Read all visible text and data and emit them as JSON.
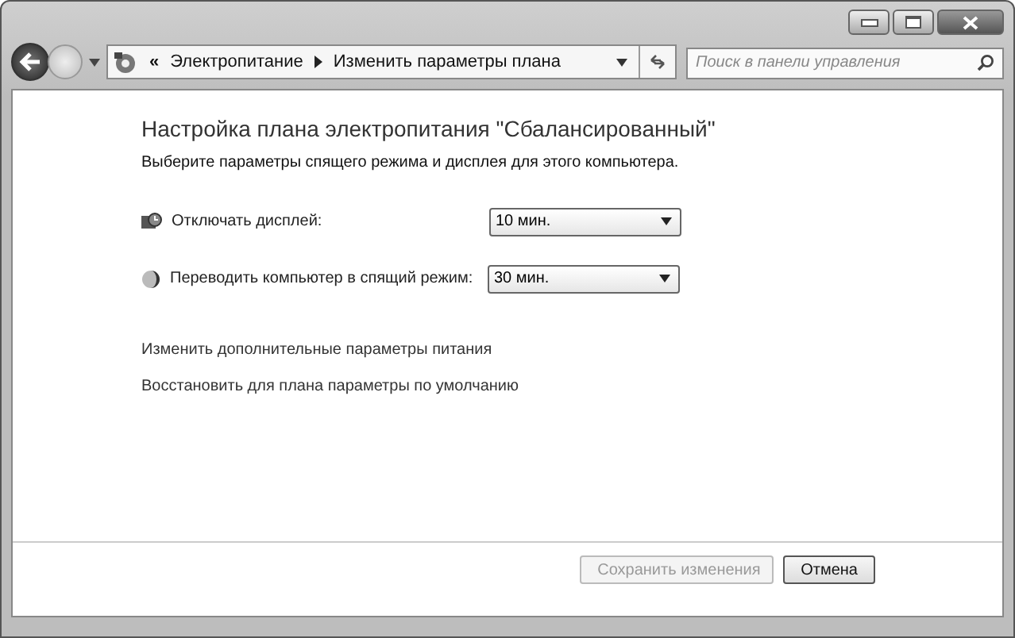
{
  "address_bar": {
    "overflow": "«",
    "crumbs": [
      "Электропитание",
      "Изменить параметры плана"
    ]
  },
  "search": {
    "placeholder": "Поиск в панели управления"
  },
  "heading": "Настройка плана электропитания \"Сбалансированный\"",
  "subtitle": "Выберите параметры спящего режима и дисплея для этого компьютера.",
  "settings": [
    {
      "kind": "display",
      "label": "Отключать дисплей:",
      "value": "10 мин."
    },
    {
      "kind": "sleep",
      "label": "Переводить компьютер в спящий режим:",
      "value": "30 мин."
    }
  ],
  "links": [
    "Изменить дополнительные параметры питания",
    "Восстановить для плана параметры по умолчанию"
  ],
  "buttons": [
    {
      "label": "Сохранить изменения",
      "disabled": true
    },
    {
      "label": "Отмена",
      "disabled": false
    }
  ]
}
